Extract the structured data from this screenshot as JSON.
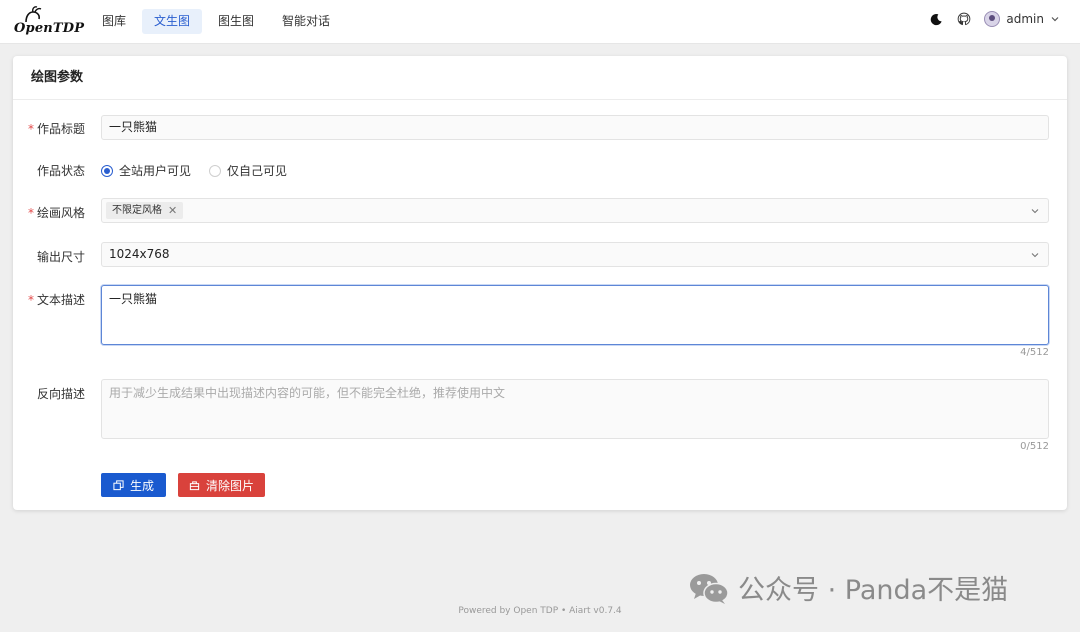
{
  "brand": {
    "logo_text": "OpenTDP"
  },
  "nav": [
    {
      "label": "图库",
      "active": false
    },
    {
      "label": "文生图",
      "active": true
    },
    {
      "label": "图生图",
      "active": false
    },
    {
      "label": "智能对话",
      "active": false
    }
  ],
  "user": {
    "name": "admin"
  },
  "card": {
    "title": "绘图参数"
  },
  "form": {
    "title": {
      "label": "作品标题",
      "required": true,
      "value": "一只熊猫"
    },
    "status": {
      "label": "作品状态",
      "options": [
        {
          "label": "全站用户可见",
          "checked": true
        },
        {
          "label": "仅自己可见",
          "checked": false
        }
      ]
    },
    "style": {
      "label": "绘画风格",
      "required": true,
      "tags": [
        "不限定风格"
      ]
    },
    "size": {
      "label": "输出尺寸",
      "value": "1024x768"
    },
    "prompt": {
      "label": "文本描述",
      "required": true,
      "value": "一只熊猫",
      "counter": "4/512"
    },
    "negative": {
      "label": "反向描述",
      "placeholder": "用于减少生成结果中出现描述内容的可能，但不能完全杜绝，推荐使用中文",
      "counter": "0/512"
    }
  },
  "buttons": {
    "generate": "生成",
    "clear": "清除图片"
  },
  "watermark": "公众号 · Panda不是猫",
  "footer": "Powered by Open TDP • Aiart v0.7.4",
  "colors": {
    "primary": "#1a5acf",
    "danger": "#d9423c",
    "required": "#e24a4a"
  }
}
